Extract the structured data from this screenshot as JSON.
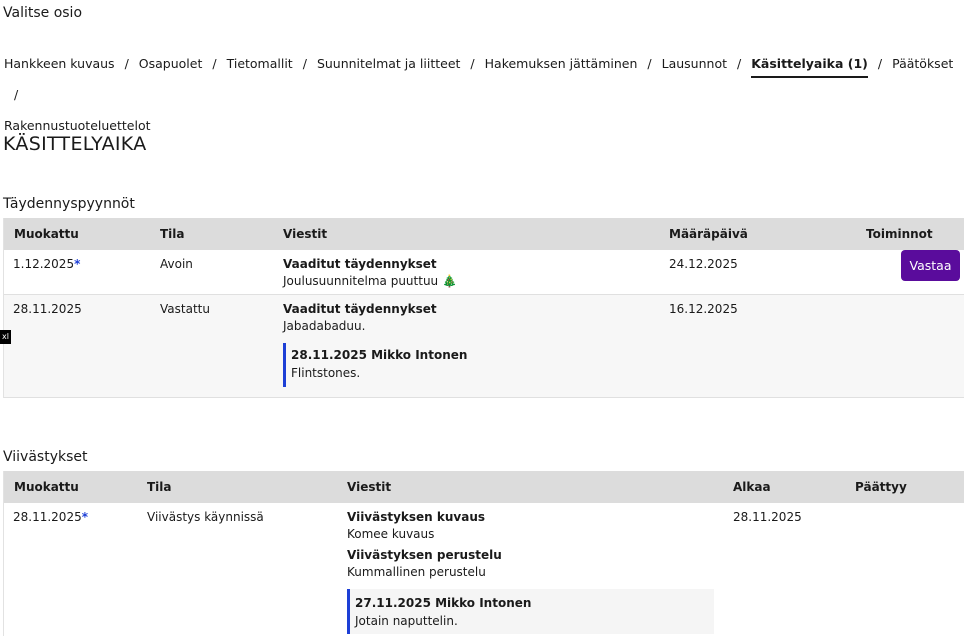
{
  "section_label": "Valitse osio",
  "nav": {
    "items": [
      {
        "label": "Hankkeen kuvaus"
      },
      {
        "label": "Osapuolet"
      },
      {
        "label": "Tietomallit"
      },
      {
        "label": "Suunnitelmat ja liitteet"
      },
      {
        "label": "Hakemuksen jättäminen"
      },
      {
        "label": "Lausunnot"
      },
      {
        "label": "Käsittelyaika (1)",
        "active": true
      },
      {
        "label": "Päätökset"
      },
      {
        "label": "Rakennustuoteluettelot"
      }
    ],
    "separator": "/"
  },
  "page_title": "KÄSITTELYAIKA",
  "supplement": {
    "title": "Täydennyspyynnöt",
    "headers": {
      "modified": "Muokattu",
      "state": "Tila",
      "messages": "Viestit",
      "deadline": "Määräpäivä",
      "actions": "Toiminnot"
    },
    "rows": [
      {
        "modified": "1.12.2025",
        "asterisk": "*",
        "state": "Avoin",
        "msg_title": "Vaaditut täydennykset",
        "msg_body": "Joulusuunnitelma puuttuu 🎄",
        "deadline": "24.12.2025",
        "action_label": "Vastaa"
      },
      {
        "modified": "28.11.2025",
        "state": "Vastattu",
        "msg_title": "Vaaditut täydennykset",
        "msg_body": "Jabadabaduu.",
        "deadline": "16.12.2025",
        "reply_head": "28.11.2025 Mikko Intonen",
        "reply_body": "Flintstones."
      }
    ]
  },
  "delays": {
    "title": "Viivästykset",
    "headers": {
      "modified": "Muokattu",
      "state": "Tila",
      "messages": "Viestit",
      "starts": "Alkaa",
      "ends": "Päättyy"
    },
    "rows": [
      {
        "modified": "28.11.2025",
        "asterisk": "*",
        "state": "Viivästys käynnissä",
        "desc_title": "Viivästyksen kuvaus",
        "desc_body": "Komee kuvaus",
        "reason_title": "Viivästyksen perustelu",
        "reason_body": "Kummallinen perustelu",
        "starts": "28.11.2025",
        "reply_head": "27.11.2025 Mikko Intonen",
        "reply_body": "Jotain naputtelin."
      }
    ]
  },
  "badge": "xl",
  "colors": {
    "accent": "#1d3fd6",
    "button": "#5a0c9c",
    "header_bg": "#dcdcdc"
  }
}
